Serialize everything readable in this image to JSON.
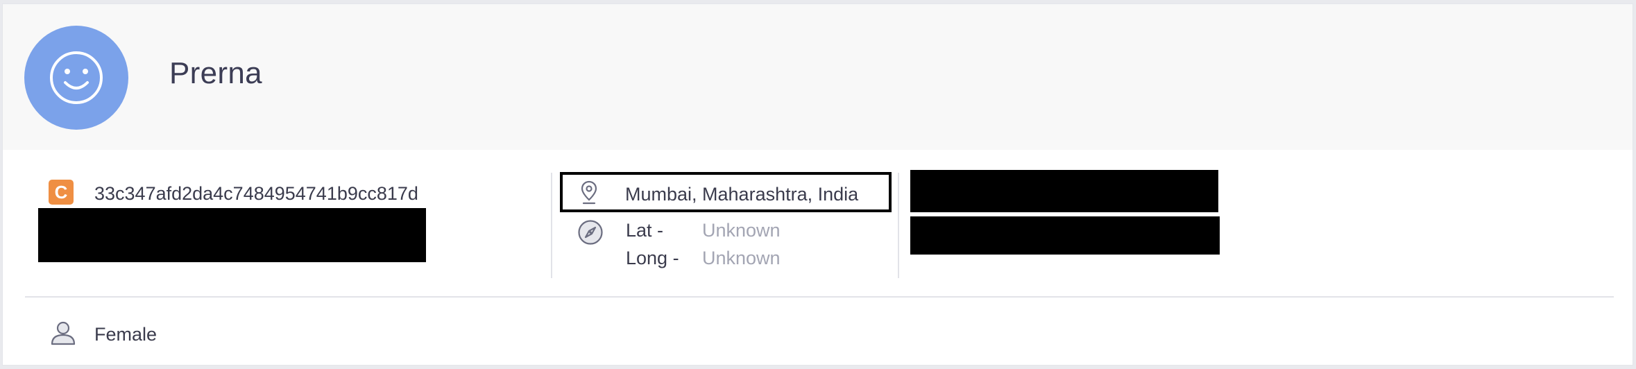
{
  "profile": {
    "name": "Prerna",
    "avatar_icon": "smiley-face-icon",
    "badge_letter": "C",
    "id": "33c347afd2da4c7484954741b9cc817d",
    "location": "Mumbai, Maharashtra, India",
    "lat_label": "Lat -",
    "lat_value": "Unknown",
    "long_label": "Long -",
    "long_value": "Unknown",
    "gender": "Female"
  },
  "icons": {
    "location": "map-pin-icon",
    "coordinates": "compass-icon",
    "gender": "person-icon"
  },
  "colors": {
    "avatar_bg": "#7ba2ea",
    "badge_bg": "#ef8f43",
    "header_bg": "#f8f8f8",
    "muted_text": "#a3a5b3",
    "text": "#3a3b4c"
  }
}
